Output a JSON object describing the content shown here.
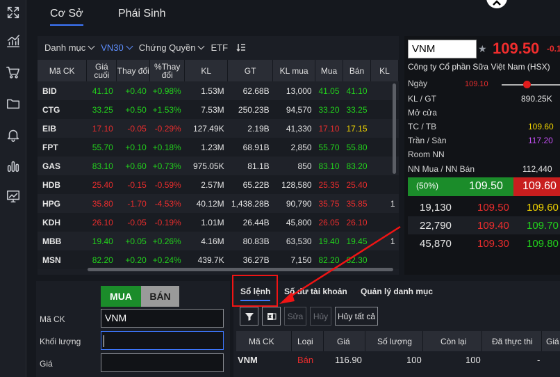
{
  "header": {
    "tabs": [
      {
        "label": "Cơ Sở",
        "active": true
      },
      {
        "label": "Phái Sinh",
        "active": false
      }
    ]
  },
  "sidebar": {
    "items": [
      {
        "icon": "fullscreen-icon"
      },
      {
        "icon": "chart-icon"
      },
      {
        "icon": "cart-icon"
      },
      {
        "icon": "folder-icon"
      },
      {
        "icon": "bell-icon"
      },
      {
        "icon": "bar-chart-icon"
      },
      {
        "icon": "monitor-chart-icon"
      }
    ]
  },
  "filters": {
    "category": "Danh mục",
    "vn30": "VN30",
    "warrant": "Chứng Quyền",
    "etf": "ETF"
  },
  "market": {
    "columns": [
      "Mã CK",
      "Giá cuối",
      "Thay đổi",
      "%Thay đổi",
      "KL",
      "GT",
      "KL mua",
      "Mua",
      "Bán",
      "KL"
    ],
    "rows": [
      {
        "sym": "BID",
        "last": "41.10",
        "chg": "+0.40",
        "pct": "+0.98%",
        "vol": "1.53M",
        "val": "62.68B",
        "bvol": "13,000",
        "bid": "41.05",
        "ask": "41.10",
        "avol": "",
        "c": "up",
        "bc": "up",
        "ac": "up"
      },
      {
        "sym": "CTG",
        "last": "33.25",
        "chg": "+0.50",
        "pct": "+1.53%",
        "vol": "7.53M",
        "val": "250.23B",
        "bvol": "94,570",
        "bid": "33.20",
        "ask": "33.25",
        "avol": "",
        "c": "up",
        "bc": "up",
        "ac": "up"
      },
      {
        "sym": "EIB",
        "last": "17.10",
        "chg": "-0.05",
        "pct": "-0.29%",
        "vol": "127.49K",
        "val": "2.19B",
        "bvol": "41,330",
        "bid": "17.10",
        "ask": "17.15",
        "avol": "",
        "c": "dn",
        "bc": "dn",
        "ac": "ref"
      },
      {
        "sym": "FPT",
        "last": "55.70",
        "chg": "+0.10",
        "pct": "+0.18%",
        "vol": "1.23M",
        "val": "68.91B",
        "bvol": "2,850",
        "bid": "55.70",
        "ask": "55.80",
        "avol": "",
        "c": "up",
        "bc": "up",
        "ac": "up"
      },
      {
        "sym": "GAS",
        "last": "83.10",
        "chg": "+0.60",
        "pct": "+0.73%",
        "vol": "975.05K",
        "val": "81.1B",
        "bvol": "850",
        "bid": "83.10",
        "ask": "83.20",
        "avol": "",
        "c": "up",
        "bc": "up",
        "ac": "up"
      },
      {
        "sym": "HDB",
        "last": "25.40",
        "chg": "-0.15",
        "pct": "-0.59%",
        "vol": "2.57M",
        "val": "65.22B",
        "bvol": "128,580",
        "bid": "25.35",
        "ask": "25.40",
        "avol": "",
        "c": "dn",
        "bc": "dn",
        "ac": "dn"
      },
      {
        "sym": "HPG",
        "last": "35.80",
        "chg": "-1.70",
        "pct": "-4.53%",
        "vol": "40.12M",
        "val": "1,438.28B",
        "bvol": "90,790",
        "bid": "35.75",
        "ask": "35.85",
        "avol": "1",
        "c": "dn",
        "bc": "dn",
        "ac": "dn"
      },
      {
        "sym": "KDH",
        "last": "26.10",
        "chg": "-0.05",
        "pct": "-0.19%",
        "vol": "1.01M",
        "val": "26.44B",
        "bvol": "45,800",
        "bid": "26.05",
        "ask": "26.10",
        "avol": "",
        "c": "dn",
        "bc": "dn",
        "ac": "dn"
      },
      {
        "sym": "MBB",
        "last": "19.40",
        "chg": "+0.05",
        "pct": "+0.26%",
        "vol": "4.16M",
        "val": "80.83B",
        "bvol": "63,530",
        "bid": "19.40",
        "ask": "19.45",
        "avol": "1",
        "c": "up",
        "bc": "up",
        "ac": "up"
      },
      {
        "sym": "MSN",
        "last": "82.20",
        "chg": "+0.20",
        "pct": "+0.24%",
        "vol": "439.7K",
        "val": "36.27B",
        "bvol": "7,150",
        "bid": "82.20",
        "ask": "82.30",
        "avol": "",
        "c": "up",
        "bc": "up",
        "ac": "up"
      }
    ]
  },
  "quote": {
    "symbol": "VNM",
    "price": "109.50",
    "change": "-0.1",
    "company": "Công ty Cổ phần Sữa Việt Nam (HSX)",
    "day_label": "Ngày",
    "day_low": "109.10",
    "kl_gt_label": "KL / GT",
    "kl_gt": "890.25K",
    "open_label": "Mở cửa",
    "tc_tb_label": "TC / TB",
    "tc": "109.60",
    "ceil_floor_label": "Trần / Sàn",
    "ceil": "117.20",
    "room_label": "Room NN",
    "nn_label": "NN Mua / NN Bán",
    "nn_buy": "112,440",
    "ratio": "(50%)",
    "best_bid": "109.50",
    "best_ask": "109.60",
    "book": [
      {
        "vol": "19,130",
        "bid": "109.50",
        "ask": "109.60"
      },
      {
        "vol": "22,790",
        "bid": "109.40",
        "ask": "109.70"
      },
      {
        "vol": "45,870",
        "bid": "109.30",
        "ask": "109.80"
      }
    ]
  },
  "order": {
    "buy_label": "MUA",
    "sell_label": "BÁN",
    "symbol_label": "Mã CK",
    "symbol_value": "VNM",
    "volume_label": "Khối lượng",
    "volume_value": "",
    "price_label": "Giá",
    "price_value": ""
  },
  "orders": {
    "tabs": [
      "Sổ lệnh",
      "Số dư tài khoản",
      "Quản lý danh mục"
    ],
    "tools": {
      "modify": "Sửa",
      "cancel": "Hủy",
      "cancel_all": "Hủy tất cả"
    },
    "columns": [
      "Mã CK",
      "Loại",
      "Giá",
      "Số lượng",
      "Còn lại",
      "Đã thực thi",
      "Giá"
    ],
    "row": {
      "sym": "VNM",
      "type": "Bán",
      "price": "116.90",
      "qty": "100",
      "remain": "100",
      "done": "-"
    }
  },
  "colors": {
    "up": "#22d11c",
    "down": "#ea2d2d",
    "ref": "#f0d400",
    "ceil": "#c04ff0",
    "accent": "#3e78ff"
  }
}
